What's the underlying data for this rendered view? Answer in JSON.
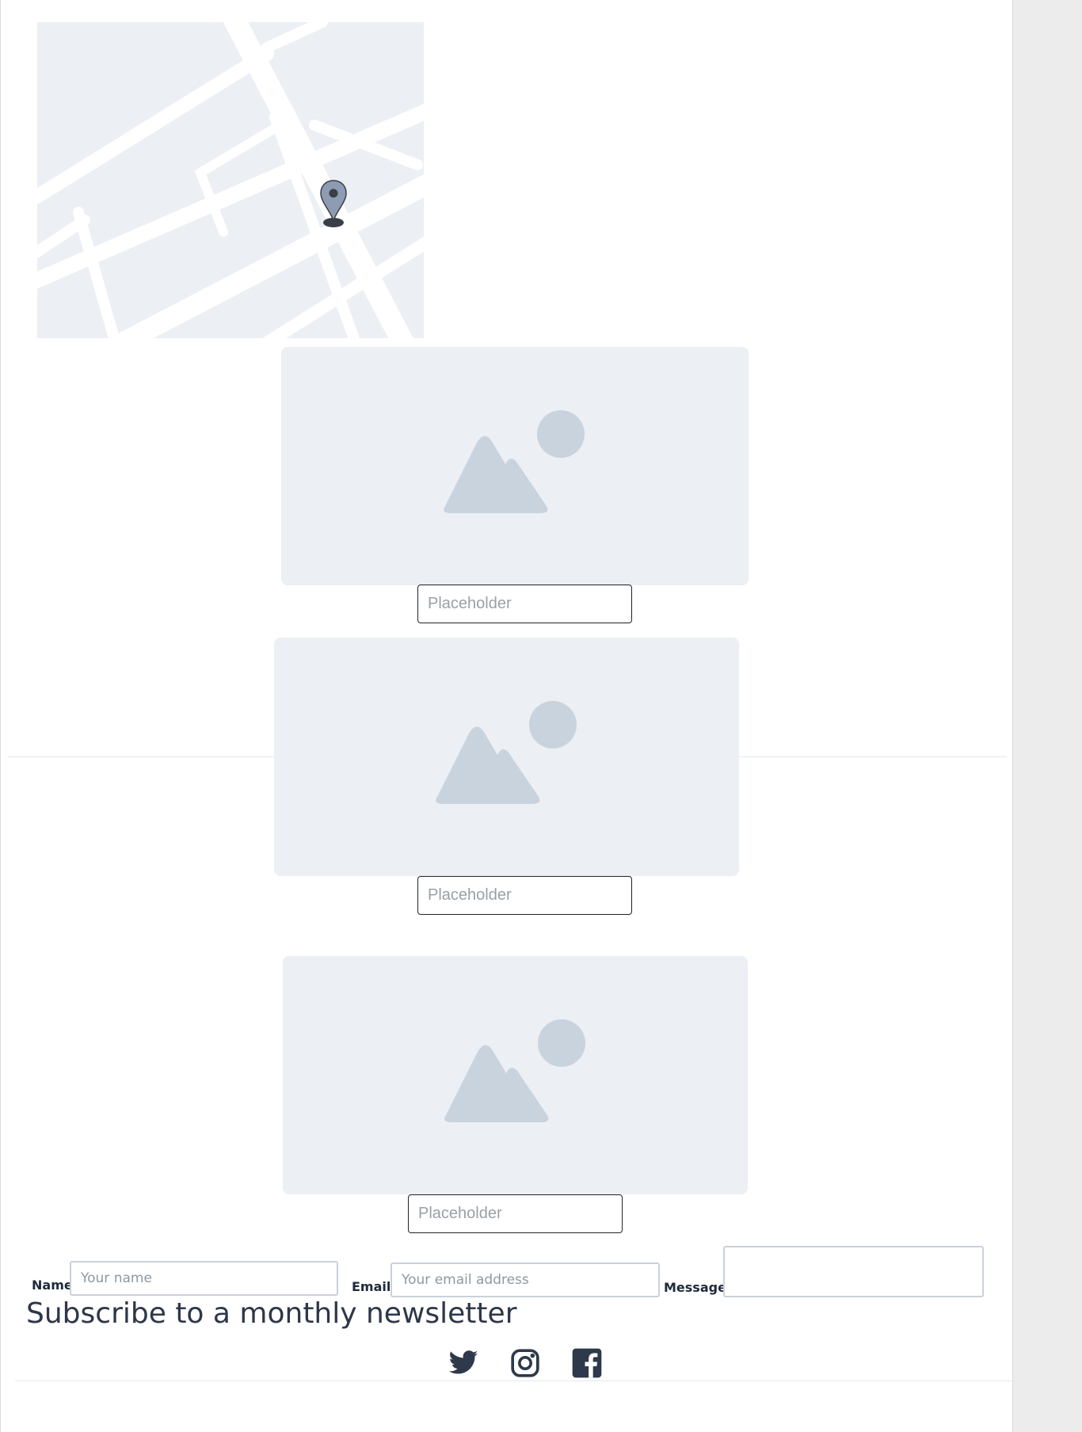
{
  "map": {
    "pin_icon": "map-pin-icon",
    "colors": {
      "land": "#eceff3",
      "road": "#ffffff",
      "pin": "#8d9cb3"
    }
  },
  "gallery": [
    {
      "icon": "image-placeholder-icon",
      "caption_placeholder": "Placeholder"
    },
    {
      "icon": "image-placeholder-icon",
      "caption_placeholder": "Placeholder"
    },
    {
      "icon": "image-placeholder-icon",
      "caption_placeholder": "Placeholder"
    }
  ],
  "contact_form": {
    "name_label": "Name",
    "name_placeholder": "Your name",
    "name_value": "",
    "email_label": "Email",
    "email_placeholder": "Your email address",
    "email_value": "",
    "message_label": "Message",
    "message_value": ""
  },
  "newsletter": {
    "headline": "Subscribe to a monthly newsletter"
  },
  "social": {
    "icons": [
      "twitter-icon",
      "instagram-icon",
      "facebook-icon"
    ]
  },
  "colors": {
    "placeholder_bg": "#eceff3",
    "placeholder_shape": "#c9d3de",
    "text_dark": "#2d3748",
    "icon": "#2e3a4b"
  }
}
